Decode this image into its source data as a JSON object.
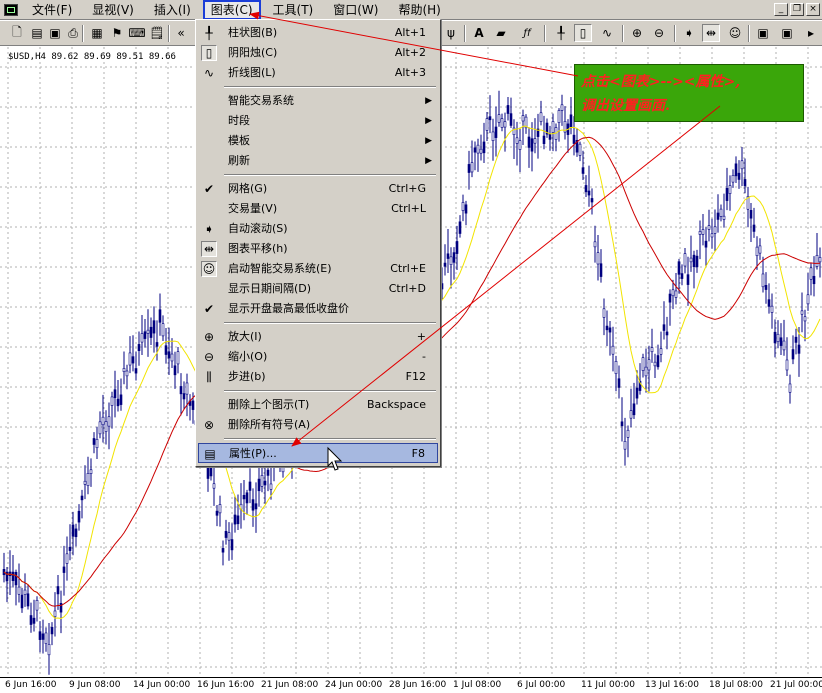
{
  "menubar": {
    "items": [
      {
        "label": "文件(F)"
      },
      {
        "label": "显视(V)"
      },
      {
        "label": "插入(I)"
      },
      {
        "label": "图表(C)"
      },
      {
        "label": "工具(T)"
      },
      {
        "label": "窗口(W)"
      },
      {
        "label": "帮助(H)"
      }
    ]
  },
  "chart": {
    "symbol_label": "$USD,H4  89.62 89.69 89.51 89.66",
    "x_axis_labels": [
      "6 Jun 16:00",
      "9 Jun 08:00",
      "14 Jun 00:00",
      "16 Jun 16:00",
      "21 Jun 08:00",
      "24 Jun 00:00",
      "28 Jun 16:00",
      "1 Jul 08:00",
      "6 Jul 00:00",
      "11 Jul 00:00",
      "13 Jul 16:00",
      "18 Jul 08:00",
      "21 Jul 00:00"
    ],
    "line_colors": {
      "fast_ma": "#f2e400",
      "slow_ma": "#cc0000",
      "candles": "#000080"
    }
  },
  "dropdown": {
    "items": [
      {
        "icon": "bar-chart-icon",
        "label": "柱状图(B)",
        "shortcut": "Alt+1",
        "type": "item"
      },
      {
        "icon": "candlestick-icon",
        "label": "阴阳烛(C)",
        "shortcut": "Alt+2",
        "type": "item",
        "boxed": true
      },
      {
        "icon": "line-chart-icon",
        "label": "折线图(L)",
        "shortcut": "Alt+3",
        "type": "item"
      },
      {
        "type": "sep"
      },
      {
        "label": "智能交易系统",
        "type": "submenu"
      },
      {
        "label": "时段",
        "type": "submenu"
      },
      {
        "label": "模板",
        "type": "submenu"
      },
      {
        "label": "刷新",
        "type": "submenu"
      },
      {
        "type": "sep"
      },
      {
        "icon": "check-icon",
        "label": "网格(G)",
        "shortcut": "Ctrl+G",
        "type": "item"
      },
      {
        "label": "交易量(V)",
        "shortcut": "Ctrl+L",
        "type": "item"
      },
      {
        "icon": "autoscroll-icon",
        "label": "自动滚动(S)",
        "shortcut": "",
        "type": "item"
      },
      {
        "icon": "chart-shift-icon",
        "label": "图表平移(h)",
        "shortcut": "",
        "type": "item",
        "boxed": true
      },
      {
        "icon": "expert-advisor-icon",
        "label": "启动智能交易系统(E)",
        "shortcut": "Ctrl+E",
        "type": "item",
        "boxed": true
      },
      {
        "label": "显示日期间隔(D)",
        "shortcut": "Ctrl+D",
        "type": "item"
      },
      {
        "icon": "check-icon",
        "label": "显示开盘最高最低收盘价",
        "shortcut": "",
        "type": "item"
      },
      {
        "type": "sep"
      },
      {
        "icon": "zoom-in-icon",
        "label": "放大(I)",
        "shortcut": "+",
        "type": "item"
      },
      {
        "icon": "zoom-out-icon",
        "label": "缩小(O)",
        "shortcut": "-",
        "type": "item"
      },
      {
        "icon": "step-icon",
        "label": "步进(b)",
        "shortcut": "F12",
        "type": "item"
      },
      {
        "type": "sep"
      },
      {
        "label": "删除上个图示(T)",
        "shortcut": "Backspace",
        "type": "item"
      },
      {
        "icon": "delete-objects-icon",
        "label": "删除所有符号(A)",
        "shortcut": "",
        "type": "item"
      },
      {
        "type": "sep"
      },
      {
        "icon": "properties-icon",
        "label": "属性(P)...",
        "shortcut": "F8",
        "type": "item",
        "selected": true
      }
    ]
  },
  "annotation": {
    "line1": "点击<图表>--><属性>,",
    "line2": "调出设置画面."
  }
}
